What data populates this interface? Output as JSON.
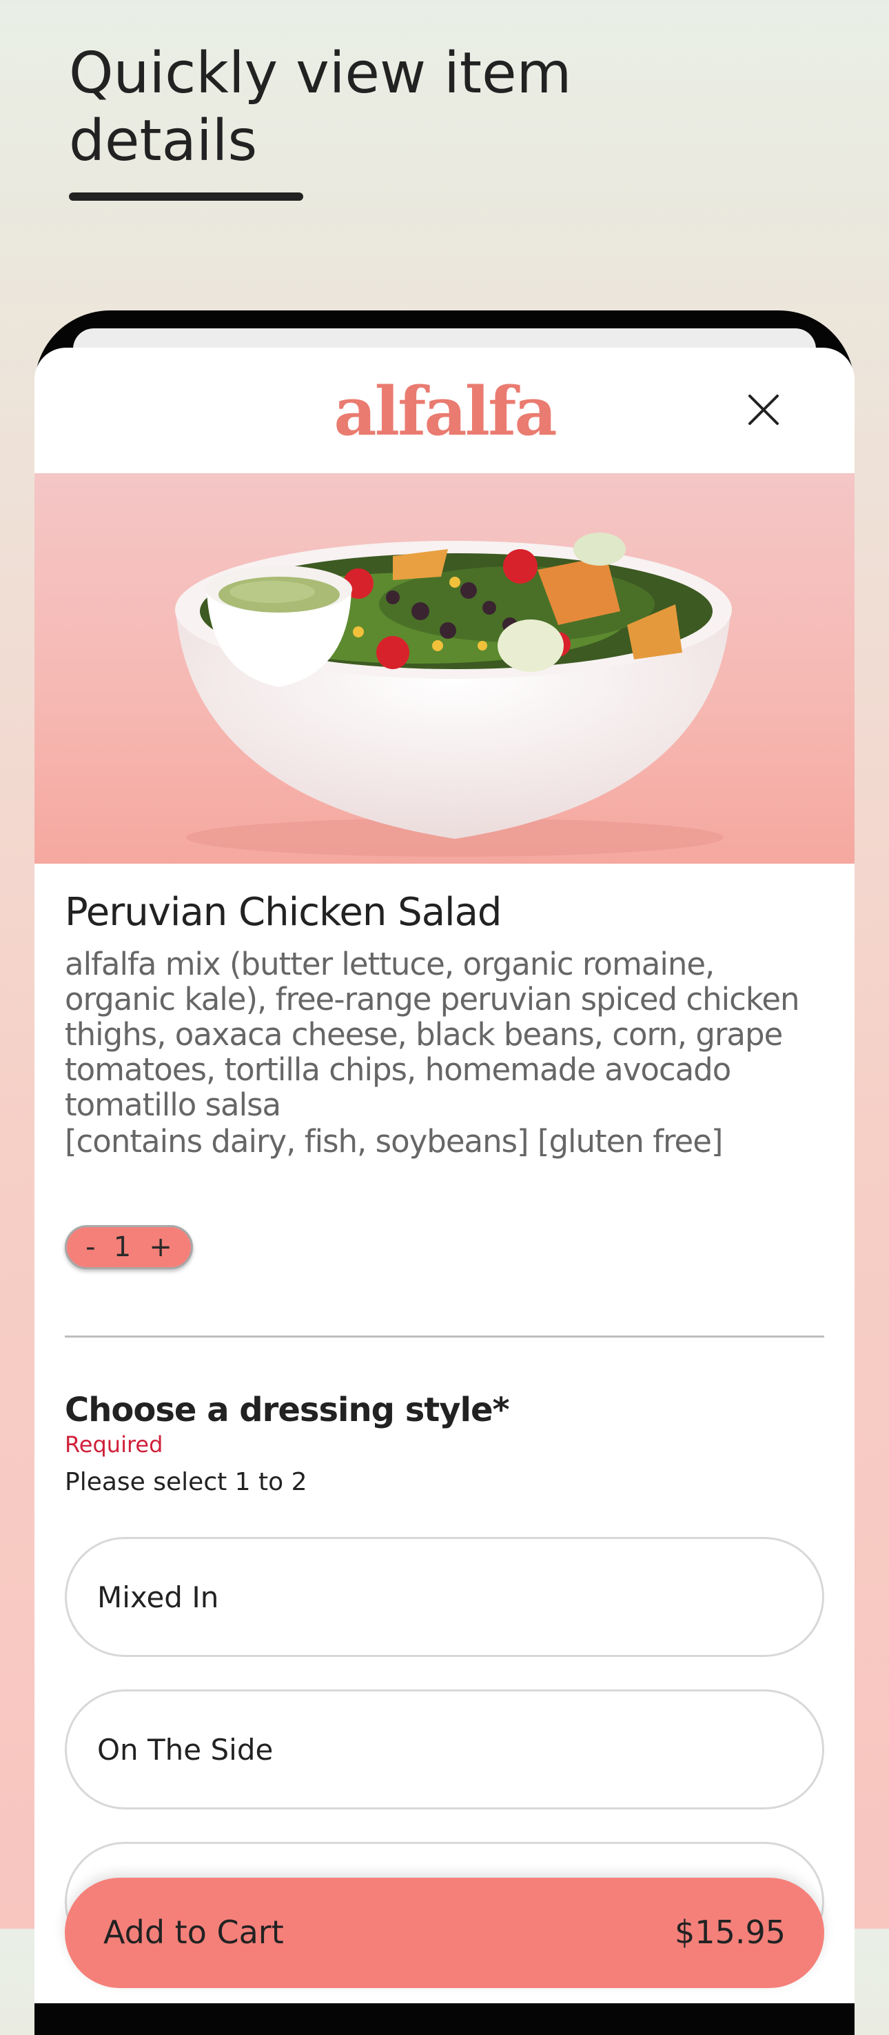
{
  "promo": {
    "title_line1": "Quickly view item",
    "title_line2": "details"
  },
  "header": {
    "brand": "alfalfa",
    "close_icon": "close-icon"
  },
  "item": {
    "name": "Peruvian Chicken Salad",
    "description": "alfalfa mix (butter lettuce, organic romaine, organic kale), free-range peruvian spiced chicken thighs, oaxaca cheese, black beans, corn, grape tomatoes, tortilla chips, homemade avocado tomatillo salsa",
    "allergens": "[contains dairy, fish, soybeans] [gluten free]",
    "image": "salad-bowl-photo"
  },
  "quantity": {
    "decrement": "-",
    "value": "1",
    "increment": "+"
  },
  "dressing": {
    "title": "Choose a dressing style*",
    "required": "Required",
    "hint": "Please select 1 to 2",
    "options": [
      "Mixed In",
      "On The Side"
    ]
  },
  "cart": {
    "label": "Add to Cart",
    "price": "$15.95"
  },
  "colors": {
    "accent": "#f5807a",
    "brand": "#ea7b70",
    "required": "#d0203a"
  }
}
